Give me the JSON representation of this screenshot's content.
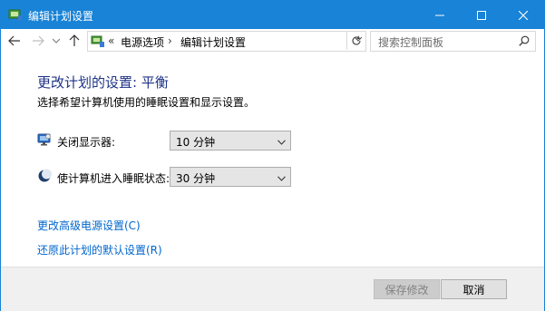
{
  "window": {
    "title": "编辑计划设置"
  },
  "address_bar": {
    "crumb_prefix": "«",
    "crumbs": [
      "电源选项",
      "编辑计划设置"
    ],
    "crumb_sep": "›"
  },
  "search": {
    "placeholder": "搜索控制面板"
  },
  "main": {
    "heading": "更改计划的设置: 平衡",
    "subtext": "选择希望计算机使用的睡眠设置和显示设置。",
    "display_off": {
      "label": "关闭显示器:",
      "value": "10 分钟"
    },
    "sleep": {
      "label": "使计算机进入睡眠状态:",
      "value": "30 分钟"
    },
    "links": {
      "advanced": "更改高级电源设置(C)",
      "restore": "还原此计划的默认设置(R)"
    }
  },
  "footer": {
    "save_label": "保存修改",
    "cancel_label": "取消"
  },
  "colors": {
    "titlebar": "#1883d7",
    "heading": "#1e3287",
    "link": "#0066cc"
  },
  "icons": {
    "app": "power-options-icon",
    "display": "monitor-icon",
    "sleep": "moon-icon"
  }
}
